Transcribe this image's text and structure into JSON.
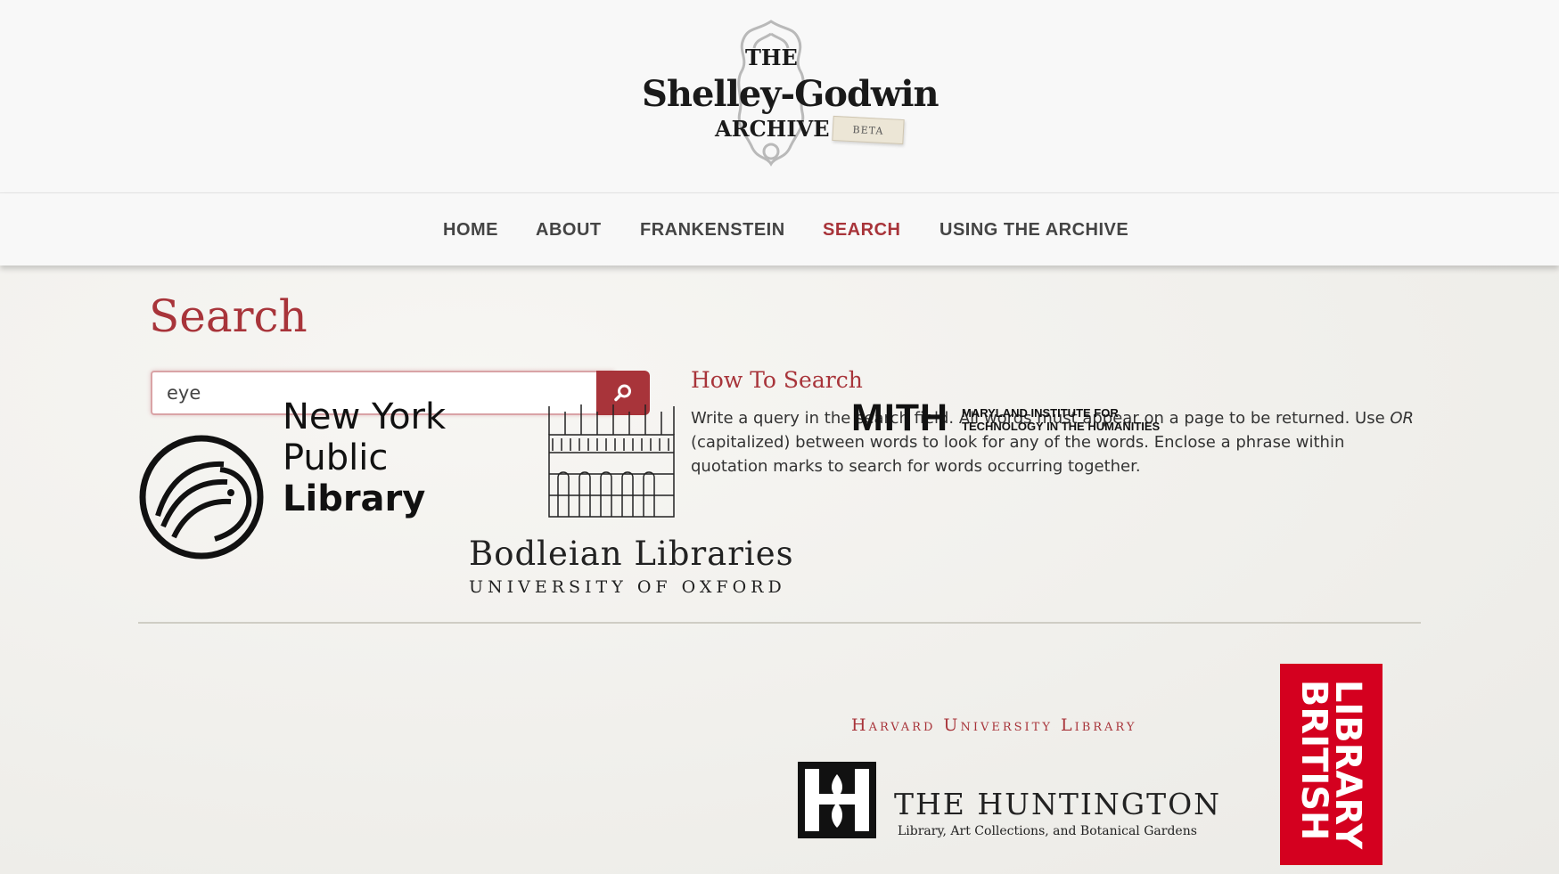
{
  "logo": {
    "line1": "THE",
    "line2": "Shelley-Godwin",
    "line3": "ARCHIVE",
    "badge": "BETA"
  },
  "nav": {
    "items": [
      {
        "label": "HOME",
        "active": false
      },
      {
        "label": "ABOUT",
        "active": false
      },
      {
        "label": "FRANKENSTEIN",
        "active": false
      },
      {
        "label": "SEARCH",
        "active": true
      },
      {
        "label": "USING THE ARCHIVE",
        "active": false
      }
    ]
  },
  "main": {
    "title": "Search",
    "search": {
      "value": "eye",
      "button_icon": "search-icon"
    },
    "howto": {
      "title": "How To Search",
      "text_before": "Write a query in the search field. All words must appear on a page to be returned. Use ",
      "text_em": "OR",
      "text_after": " (capitalized) between words to look for any of the words. Enclose a phrase within quotation marks to search for words occurring together."
    }
  },
  "partners": {
    "nypl": {
      "line1": "New York",
      "line2": "Public",
      "line3": "Library"
    },
    "bodleian": {
      "line1": "Bodleian Libraries",
      "line2": "UNIVERSITY OF OXFORD"
    },
    "mith": {
      "big": "MITH",
      "small1": "MARYLAND INSTITUTE FOR",
      "small2": "TECHNOLOGY IN THE HUMANITIES"
    },
    "harvard": "Harvard University Library",
    "huntington": {
      "title": "THE HUNTINGTON",
      "subtitle": "Library, Art Collections, and Botanical Gardens"
    },
    "british_library": {
      "line1": "BRITISH",
      "line2": "LIBRARY"
    }
  },
  "colors": {
    "accent": "#a8343a",
    "british_library_red": "#d4001f"
  }
}
